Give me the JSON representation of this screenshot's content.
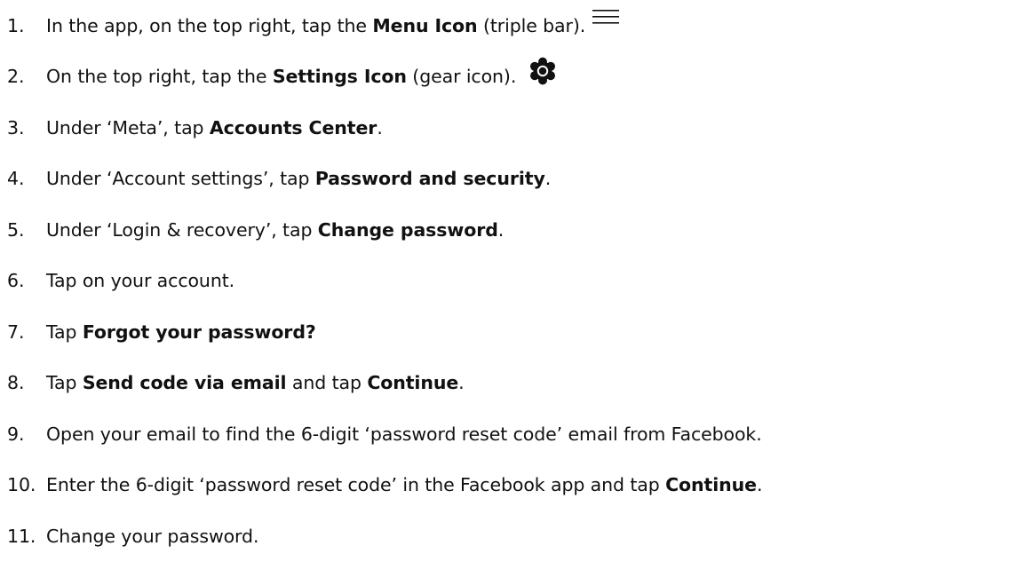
{
  "steps": [
    {
      "num": "1.",
      "parts": [
        "In the app, on the top right, tap the ",
        "Menu Icon",
        " (triple bar)."
      ],
      "icon": "menu-icon"
    },
    {
      "num": "2.",
      "parts": [
        "On the top right, tap the ",
        "Settings Icon",
        " (gear icon)."
      ],
      "icon": "gear-icon"
    },
    {
      "num": "3.",
      "parts": [
        "Under ‘Meta’, tap ",
        "Accounts Center",
        "."
      ]
    },
    {
      "num": "4.",
      "parts": [
        "Under ‘Account settings’, tap ",
        "Password and security",
        "."
      ]
    },
    {
      "num": "5.",
      "parts": [
        "Under ‘Login & recovery’, tap ",
        "Change password",
        "."
      ]
    },
    {
      "num": "6.",
      "parts": [
        "Tap on your account."
      ]
    },
    {
      "num": "7.",
      "parts": [
        "Tap ",
        "Forgot your password?"
      ]
    },
    {
      "num": "8.",
      "parts": [
        "Tap ",
        "Send code via email",
        " and tap ",
        "Continue",
        "."
      ]
    },
    {
      "num": "9.",
      "parts": [
        "Open your email to find the 6-digit ‘password reset code’ email from Facebook."
      ]
    },
    {
      "num": "10.",
      "parts": [
        "Enter the 6-digit ‘password reset code’ in the Facebook app and tap ",
        "Continue",
        "."
      ]
    },
    {
      "num": "11.",
      "parts": [
        "Change your password."
      ]
    }
  ]
}
